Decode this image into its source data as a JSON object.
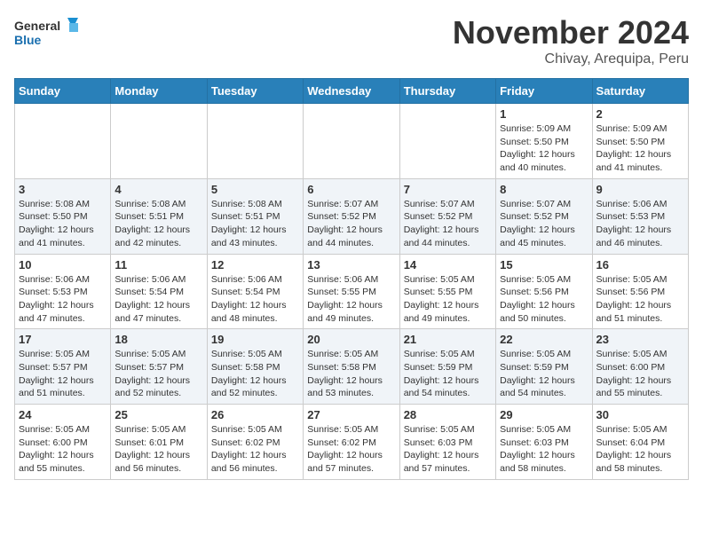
{
  "header": {
    "logo_line1": "General",
    "logo_line2": "Blue",
    "month": "November 2024",
    "location": "Chivay, Arequipa, Peru"
  },
  "weekdays": [
    "Sunday",
    "Monday",
    "Tuesday",
    "Wednesday",
    "Thursday",
    "Friday",
    "Saturday"
  ],
  "weeks": [
    [
      {
        "day": "",
        "info": ""
      },
      {
        "day": "",
        "info": ""
      },
      {
        "day": "",
        "info": ""
      },
      {
        "day": "",
        "info": ""
      },
      {
        "day": "",
        "info": ""
      },
      {
        "day": "1",
        "info": "Sunrise: 5:09 AM\nSunset: 5:50 PM\nDaylight: 12 hours\nand 40 minutes."
      },
      {
        "day": "2",
        "info": "Sunrise: 5:09 AM\nSunset: 5:50 PM\nDaylight: 12 hours\nand 41 minutes."
      }
    ],
    [
      {
        "day": "3",
        "info": "Sunrise: 5:08 AM\nSunset: 5:50 PM\nDaylight: 12 hours\nand 41 minutes."
      },
      {
        "day": "4",
        "info": "Sunrise: 5:08 AM\nSunset: 5:51 PM\nDaylight: 12 hours\nand 42 minutes."
      },
      {
        "day": "5",
        "info": "Sunrise: 5:08 AM\nSunset: 5:51 PM\nDaylight: 12 hours\nand 43 minutes."
      },
      {
        "day": "6",
        "info": "Sunrise: 5:07 AM\nSunset: 5:52 PM\nDaylight: 12 hours\nand 44 minutes."
      },
      {
        "day": "7",
        "info": "Sunrise: 5:07 AM\nSunset: 5:52 PM\nDaylight: 12 hours\nand 44 minutes."
      },
      {
        "day": "8",
        "info": "Sunrise: 5:07 AM\nSunset: 5:52 PM\nDaylight: 12 hours\nand 45 minutes."
      },
      {
        "day": "9",
        "info": "Sunrise: 5:06 AM\nSunset: 5:53 PM\nDaylight: 12 hours\nand 46 minutes."
      }
    ],
    [
      {
        "day": "10",
        "info": "Sunrise: 5:06 AM\nSunset: 5:53 PM\nDaylight: 12 hours\nand 47 minutes."
      },
      {
        "day": "11",
        "info": "Sunrise: 5:06 AM\nSunset: 5:54 PM\nDaylight: 12 hours\nand 47 minutes."
      },
      {
        "day": "12",
        "info": "Sunrise: 5:06 AM\nSunset: 5:54 PM\nDaylight: 12 hours\nand 48 minutes."
      },
      {
        "day": "13",
        "info": "Sunrise: 5:06 AM\nSunset: 5:55 PM\nDaylight: 12 hours\nand 49 minutes."
      },
      {
        "day": "14",
        "info": "Sunrise: 5:05 AM\nSunset: 5:55 PM\nDaylight: 12 hours\nand 49 minutes."
      },
      {
        "day": "15",
        "info": "Sunrise: 5:05 AM\nSunset: 5:56 PM\nDaylight: 12 hours\nand 50 minutes."
      },
      {
        "day": "16",
        "info": "Sunrise: 5:05 AM\nSunset: 5:56 PM\nDaylight: 12 hours\nand 51 minutes."
      }
    ],
    [
      {
        "day": "17",
        "info": "Sunrise: 5:05 AM\nSunset: 5:57 PM\nDaylight: 12 hours\nand 51 minutes."
      },
      {
        "day": "18",
        "info": "Sunrise: 5:05 AM\nSunset: 5:57 PM\nDaylight: 12 hours\nand 52 minutes."
      },
      {
        "day": "19",
        "info": "Sunrise: 5:05 AM\nSunset: 5:58 PM\nDaylight: 12 hours\nand 52 minutes."
      },
      {
        "day": "20",
        "info": "Sunrise: 5:05 AM\nSunset: 5:58 PM\nDaylight: 12 hours\nand 53 minutes."
      },
      {
        "day": "21",
        "info": "Sunrise: 5:05 AM\nSunset: 5:59 PM\nDaylight: 12 hours\nand 54 minutes."
      },
      {
        "day": "22",
        "info": "Sunrise: 5:05 AM\nSunset: 5:59 PM\nDaylight: 12 hours\nand 54 minutes."
      },
      {
        "day": "23",
        "info": "Sunrise: 5:05 AM\nSunset: 6:00 PM\nDaylight: 12 hours\nand 55 minutes."
      }
    ],
    [
      {
        "day": "24",
        "info": "Sunrise: 5:05 AM\nSunset: 6:00 PM\nDaylight: 12 hours\nand 55 minutes."
      },
      {
        "day": "25",
        "info": "Sunrise: 5:05 AM\nSunset: 6:01 PM\nDaylight: 12 hours\nand 56 minutes."
      },
      {
        "day": "26",
        "info": "Sunrise: 5:05 AM\nSunset: 6:02 PM\nDaylight: 12 hours\nand 56 minutes."
      },
      {
        "day": "27",
        "info": "Sunrise: 5:05 AM\nSunset: 6:02 PM\nDaylight: 12 hours\nand 57 minutes."
      },
      {
        "day": "28",
        "info": "Sunrise: 5:05 AM\nSunset: 6:03 PM\nDaylight: 12 hours\nand 57 minutes."
      },
      {
        "day": "29",
        "info": "Sunrise: 5:05 AM\nSunset: 6:03 PM\nDaylight: 12 hours\nand 58 minutes."
      },
      {
        "day": "30",
        "info": "Sunrise: 5:05 AM\nSunset: 6:04 PM\nDaylight: 12 hours\nand 58 minutes."
      }
    ]
  ]
}
